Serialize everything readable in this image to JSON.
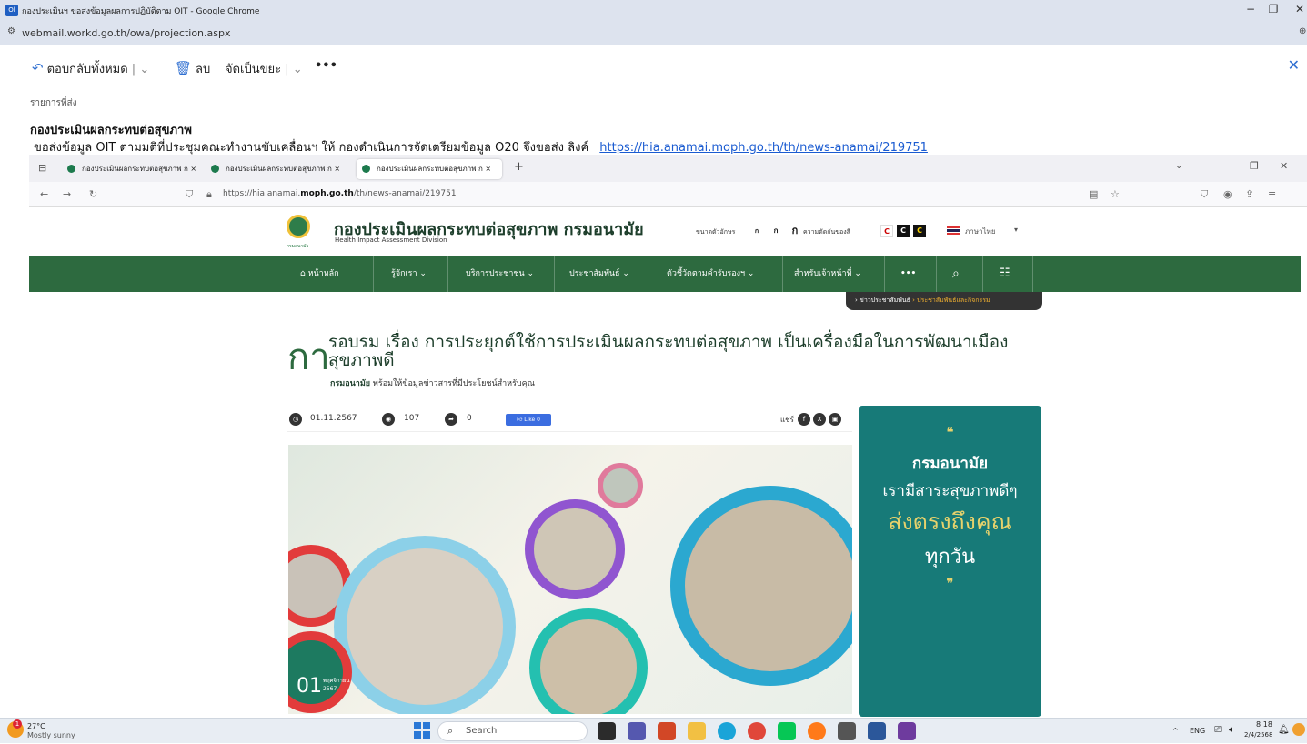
{
  "window": {
    "title": "กองประเมินฯ ขอส่งข้อมูลผลการปฏิบัติตาม OIT - Google Chrome",
    "url": "webmail.workd.go.th/owa/projection.aspx",
    "controls": [
      "−",
      "❐",
      "✕"
    ]
  },
  "owa": {
    "reply_all": "ตอบกลับทั้งหมด",
    "delete": "ลบ",
    "junk": "จัดเป็นขยะ",
    "more": "•••",
    "sent_items_label": "รายการที่ส่ง",
    "message_from": "กองประเมินผลกระทบต่อสุขภาพ",
    "message_body": "ขอส่งข้อมูล OIT   ตามมติที่ประชุมคณะทำงานขับเคลื่อนฯ ให้ กองดำเนินการจัดเตรียมข้อมูล  O20  จึงขอส่ง ลิงค์",
    "message_link": "https://hia.anamai.moph.go.th/th/news-anamai/219751"
  },
  "firefox": {
    "tabs": [
      {
        "label": "กองประเมินผลกระทบต่อสุขภาพ ก ×"
      },
      {
        "label": "กองประเมินผลกระทบต่อสุขภาพ ก ×"
      },
      {
        "label": "กองประเมินผลกระทบต่อสุขภาพ ก ×"
      }
    ],
    "new_tab": "+",
    "url_prefix": "https://hia.anamai.",
    "url_domain": "moph.go.th",
    "url_path": "/th/news-anamai/219751"
  },
  "site": {
    "name": "กองประเมินผลกระทบต่อสุขภาพ กรมอนามัย",
    "subname": "Health Impact Assessment Division",
    "logo_caption": "กรมอนามัย",
    "font_size_label": "ขนาดตัวอักษร",
    "font_sizes": [
      "ก",
      "ก",
      "ก"
    ],
    "contrast_label": "ความตัดกันของสี",
    "contrast_opts": [
      "C",
      "C",
      "C"
    ],
    "language": "ภาษาไทย",
    "nav": [
      "หน้าหลัก",
      "รู้จักเรา ⌄",
      "บริการประชาชน ⌄",
      "ประชาสัมพันธ์ ⌄",
      "ตัวชี้วัดตามคำรับรองฯ ⌄",
      "สำหรับเจ้าหน้าที่ ⌄"
    ],
    "breadcrumb_parent": "ข่าวประชาสัมพันธ์",
    "breadcrumb_current": "ประชาสัมพันธ์และกิจกรรม"
  },
  "article": {
    "initial": "กา",
    "title": "รอบรม เรื่อง การประยุกต์ใช้การประเมินผลกระทบต่อสุขภาพ เป็นเครื่องมือในการพัฒนาเมืองสุขภาพดี",
    "sub_brand": "กรมอนามัย",
    "sub_text": "พร้อมให้ข้อมูลข่าวสารที่มีประโยชน์สำหรับคุณ",
    "date": "01.11.2567",
    "views": "107",
    "shares": "0",
    "like": "Like 0",
    "share_label": "แชร์",
    "badge_day": "01",
    "badge_month": "พฤศจิกายน",
    "badge_year": "2567"
  },
  "quote_card": {
    "open": "❝",
    "line1": "กรมอนามัย",
    "line2": "เรามีสาระสุขภาพดีๆ",
    "line3": "ส่งตรงถึงคุณ",
    "line4": "ทุกวัน",
    "close": "❞"
  },
  "taskbar": {
    "temp": "27°C",
    "weather": "Mostly sunny",
    "weather_alert": "1",
    "search": "Search",
    "lang": "ENG",
    "time": "8:18",
    "date": "2/4/2568"
  },
  "colors": {
    "site_green": "#2d6a3f",
    "teal_card": "#177a78",
    "owa_blue": "#2f6fd1"
  }
}
